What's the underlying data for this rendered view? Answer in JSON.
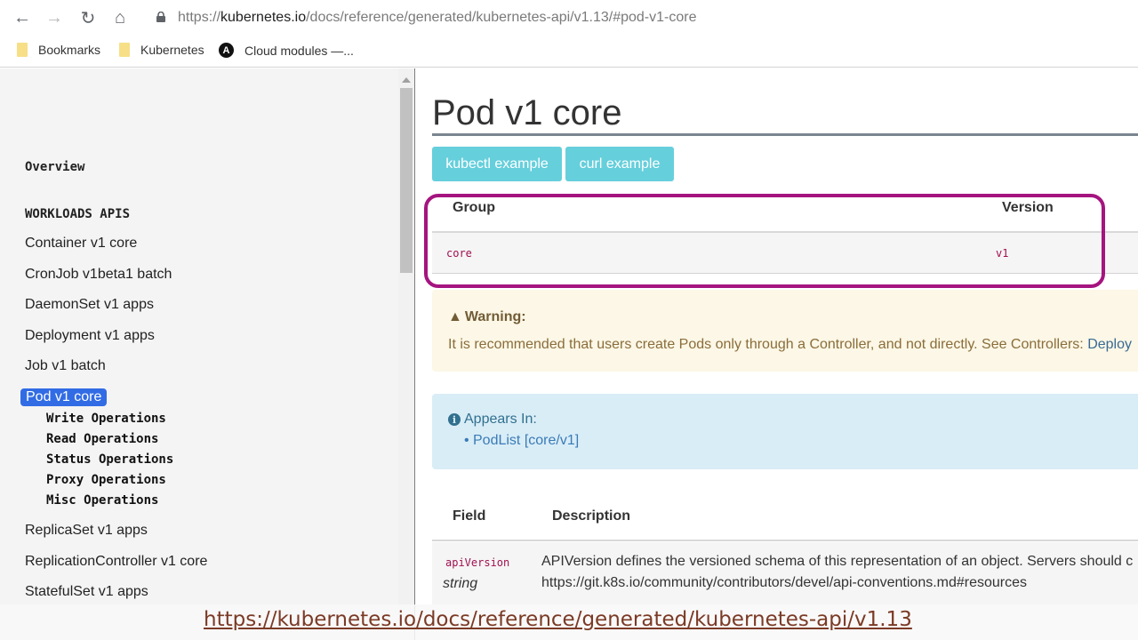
{
  "browser": {
    "url_prefix": "https://",
    "url_host": "kubernetes.io",
    "url_path": "/docs/reference/generated/kubernetes-api/v1.13/#pod-v1-core",
    "back_icon": "←",
    "forward_icon": "→",
    "reload_icon": "↻",
    "home_icon": "⌂",
    "bookmarks": [
      {
        "label": "Bookmarks",
        "icon": "folder"
      },
      {
        "label": "Kubernetes",
        "icon": "folder"
      },
      {
        "label": "Cloud modules —...",
        "icon": "ansible",
        "glyph": "A"
      }
    ]
  },
  "sidebar": {
    "overview": "Overview",
    "section_heading": "WORKLOADS APIS",
    "items": [
      "Container v1 core",
      "CronJob v1beta1 batch",
      "DaemonSet v1 apps",
      "Deployment v1 apps",
      "Job v1 batch"
    ],
    "active_item": "Pod v1 core",
    "sub_items": [
      "Write Operations",
      "Read Operations",
      "Status Operations",
      "Proxy Operations",
      "Misc Operations"
    ],
    "items_after": [
      "ReplicaSet v1 apps",
      "ReplicationController v1 core",
      "StatefulSet v1 apps"
    ]
  },
  "main": {
    "title": "Pod v1 core",
    "buttons": [
      "kubectl example",
      "curl example"
    ],
    "group_version_table": {
      "headers": [
        "Group",
        "Version"
      ],
      "rows": [
        [
          "core",
          "v1"
        ]
      ]
    },
    "warning": {
      "icon": "▲",
      "title": "Warning:",
      "text": "It is recommended that users create Pods only through a Controller, and not directly. See Controllers: ",
      "link": "Deploy"
    },
    "appears_in": {
      "icon": "i",
      "title": "Appears In:",
      "items": [
        "PodList [core/v1]"
      ]
    },
    "fields_table": {
      "headers": [
        "Field",
        "Description"
      ],
      "rows": [
        {
          "name": "apiVersion",
          "type": "string",
          "description_line1": "APIVersion defines the versioned schema of this representation of an object. Servers should c",
          "description_line2": "https://git.k8s.io/community/contributors/devel/api-conventions.md#resources"
        }
      ]
    }
  },
  "caption": {
    "text": "https://kubernetes.io/docs/reference/generated/kubernetes-api/v1.13"
  },
  "colors": {
    "accent_active": "#326ce5",
    "example_button": "#66cfdc",
    "highlight_border": "#a5147f",
    "warning_bg": "#fcf7e6",
    "info_bg": "#d9edf7",
    "code_text": "#a01050"
  }
}
